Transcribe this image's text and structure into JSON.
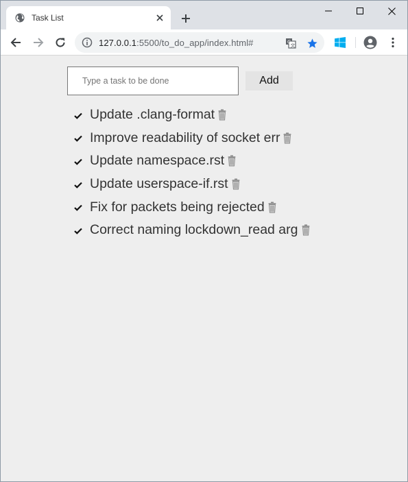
{
  "browser": {
    "tab_title": "Task List",
    "url_host": "127.0.0.1",
    "url_rest": ":5500/to_do_app/index.html#"
  },
  "app": {
    "input_placeholder": "Type a task to be done",
    "input_value": "",
    "add_label": "Add",
    "tasks": [
      {
        "text": "Update .clang-format",
        "done": true
      },
      {
        "text": "Improve readability of socket err",
        "done": true
      },
      {
        "text": "Update namespace.rst",
        "done": true
      },
      {
        "text": "Update userspace-if.rst",
        "done": true
      },
      {
        "text": "Fix for packets being rejected",
        "done": true
      },
      {
        "text": "Correct naming lockdown_read arg",
        "done": true
      }
    ]
  },
  "icons": {
    "check": "check-icon",
    "delete": "trash-icon"
  },
  "colors": {
    "star": "#1a73e8",
    "windows_logo": "#00adef",
    "page_bg": "#eeeeee"
  }
}
